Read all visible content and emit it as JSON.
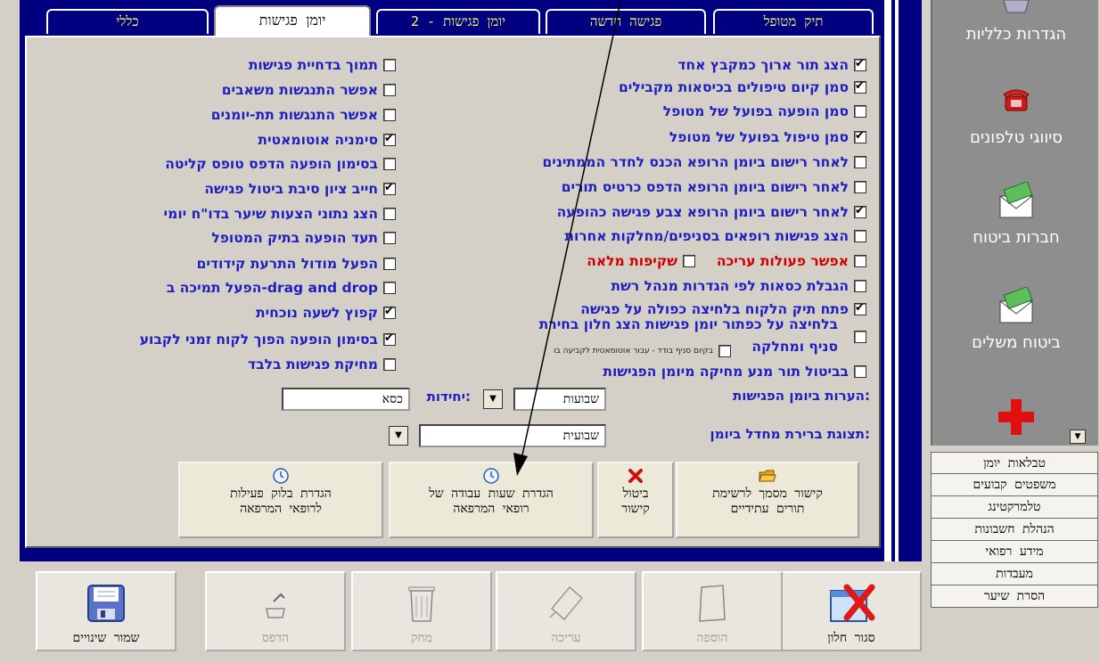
{
  "tabs": [
    {
      "label": "כללי",
      "active": false
    },
    {
      "label": "יומן פגישות",
      "active": true
    },
    {
      "label": "יומן פגישות - 2",
      "active": false
    },
    {
      "label": "פגישה חדשה",
      "active": false
    },
    {
      "label": "תיק מטופל",
      "active": false
    }
  ],
  "right_options": [
    {
      "label": "הצג תור ארוך כמקבץ אחד",
      "checked": true
    },
    {
      "label": "סמן קיום טיפולים בכיסאות מקבילים",
      "checked": true
    },
    {
      "label": "סמן הופעה בפועל של מטופל",
      "checked": false
    },
    {
      "label": "סמן טיפול בפועל של מטופל",
      "checked": true
    },
    {
      "label": "לאחר רישום ביומן הרופא הכנס לחדר הממתינים",
      "checked": false
    },
    {
      "label": "לאחר רישום ביומן הרופא הדפס כרטיס תורים",
      "checked": false
    },
    {
      "label": "לאחר רישום ביומן הרופא צבע פגישה כהופעה",
      "checked": true
    },
    {
      "label": "הצג פגישות רופאים בסניפים/מחלקות אחרות",
      "checked": false
    },
    {
      "label": "הגבלת כסאות לפי הגדרות מנהל רשת",
      "checked": false
    },
    {
      "label": "פתח תיק הלקוח בלחיצה כפולה על פגישה",
      "checked": true
    }
  ],
  "allow_edit": {
    "label": "אפשר פעולות עריכה",
    "checked": false
  },
  "transparent": {
    "label": "שקיפות מלאה",
    "checked": false
  },
  "branch_click": {
    "line1": "בלחיצה על כפתור יומן פגישות הצג חלון בחירת",
    "line2": "סניף ומחלקה",
    "checked": false
  },
  "single_branch": {
    "label": "בקיום סניף בודד - עבור אוטומאטית לקביעה בו",
    "checked": false
  },
  "cancel_block": {
    "label": "בביטול תור מנע מחיקה מיומן הפגישות",
    "checked": false
  },
  "left_options": [
    {
      "label": "תמוך בדחיית פגישות",
      "checked": false
    },
    {
      "label": "אפשר התנגשות משאבים",
      "checked": false
    },
    {
      "label": "אפשר התנגשות תת-יומנים",
      "checked": false
    },
    {
      "label": "סימניה אוטומאטית",
      "checked": true
    },
    {
      "label": "בסימון הופעה הדפס טופס קליטה",
      "checked": false
    },
    {
      "label": "חייב ציון סיבת ביטול פגישה",
      "checked": true
    },
    {
      "label": "הצג נתוני הצעות שיער בדו\"ח יומי",
      "checked": false
    },
    {
      "label": "תעד הופעה בתיק המטופל",
      "checked": false
    },
    {
      "label": "הפעל מודול התרעת קידודים",
      "checked": false
    },
    {
      "label": "הפעל תמיכה ב-drag and drop",
      "checked": false
    },
    {
      "label": "קפוץ לשעה נוכחית",
      "checked": true
    },
    {
      "label": "בסימון הופעה הפוך לקוח זמני לקבוע",
      "checked": true
    },
    {
      "label": "מחיקת פגישות בלבד",
      "checked": false
    }
  ],
  "notes": {
    "label": "הערות ביומן הפגישות:",
    "value": "שבועות"
  },
  "units": {
    "label": "יחידות:",
    "value": "כסא"
  },
  "display": {
    "label": "תצוגת ברירת מחדל ביומן:",
    "value": "שבועית"
  },
  "buttons": {
    "link_doc": {
      "line1": "קישור מסמך לרשימת",
      "line2": "תורים עתידיים"
    },
    "cancel_link": {
      "line1": "ביטול",
      "line2": "קישור"
    },
    "work_hours": {
      "line1": "הגדרת שעות עבודה של",
      "line2": "רופאי המרפאה"
    },
    "activity_block": {
      "line1": "הגדרת בלוק פעילות",
      "line2": "לרופאי המרפאה"
    }
  },
  "sidebar": {
    "items": [
      {
        "label": "הגדרות כלליות",
        "icon": "settings-book-icon"
      },
      {
        "label": "סיווגי טלפונים",
        "icon": "telephone-icon"
      },
      {
        "label": "חברות ביטוח",
        "icon": "money-envelope-icon"
      },
      {
        "label": "ביטוח משלים",
        "icon": "money-envelope-icon"
      },
      {
        "label": "",
        "icon": "red-cross-icon"
      }
    ],
    "list": [
      "טבלאות יומן",
      "משפטים קבועים",
      "טלמרקטינג",
      "הנהלת חשבונות",
      "מידע רפואי",
      "מעבדות",
      "הסרת שיער"
    ]
  },
  "bottom_bar": [
    {
      "label": "סגור חלון",
      "icon": "close-window-icon",
      "enabled": true
    },
    {
      "label": "הוספה",
      "icon": "add-page-icon",
      "enabled": false
    },
    {
      "label": "עריכה",
      "icon": "edit-icon",
      "enabled": false
    },
    {
      "label": "מחק",
      "icon": "trash-icon",
      "enabled": false
    },
    {
      "label": "הדפס",
      "icon": "printer-icon",
      "enabled": false
    },
    {
      "label": "שמור שינויים",
      "icon": "floppy-disk-icon",
      "enabled": true
    }
  ],
  "colors": {
    "label_blue": "#1f1fbf",
    "tab_blue": "#000080",
    "tab_text": "#ffff66",
    "warn_red": "#cc0000"
  }
}
